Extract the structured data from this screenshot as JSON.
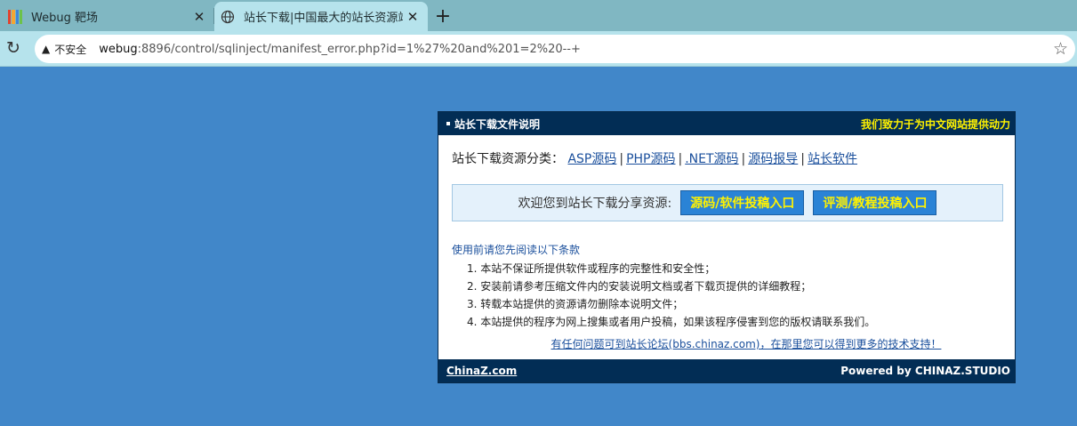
{
  "browser": {
    "tabs": [
      {
        "title": "Webug 靶场",
        "close": "✕"
      },
      {
        "title": "站长下载|中国最大的站长资源站",
        "close": "✕"
      }
    ],
    "new_tab": "+",
    "reload_icon": "↻",
    "security_label": "不安全",
    "url_host": "webug",
    "url_rest": ":8896/control/sqlinject/manifest_error.php?id=1%27%20and%201=2%20--+",
    "star_icon": "☆"
  },
  "page": {
    "header_title": "站长下载文件说明",
    "header_slogan": "我们致力于为中文网站提供动力",
    "categories_label": "站长下载资源分类：",
    "categories": [
      "ASP源码",
      "PHP源码",
      ".NET源码",
      "源码报导",
      "站长软件"
    ],
    "welcome_text": "欢迎您到站长下载分享资源:",
    "btn_submit_source": "源码/软件投稿入口",
    "btn_submit_review": "评测/教程投稿入口",
    "notice_title": "使用前请您先阅读以下条款",
    "rules": [
      "1. 本站不保证所提供软件或程序的完整性和安全性；",
      "2. 安装前请参考压缩文件内的安装说明文档或者下载页提供的详细教程；",
      "3. 转载本站提供的资源请勿删除本说明文件；",
      "4. 本站提供的程序为网上搜集或者用户投稿，如果该程序侵害到您的版权请联系我们。"
    ],
    "forum_link": "有任何问题可到站长论坛(bbs.chinaz.com)，在那里您可以得到更多的技术支持！",
    "footer_left": "ChinaZ.com",
    "footer_right": "Powered by CHINAZ.STUDIO"
  },
  "colors": {
    "background": "#4187c9",
    "panel_header": "#022d55",
    "slogan": "#fff200",
    "link": "#1a4f9c"
  }
}
